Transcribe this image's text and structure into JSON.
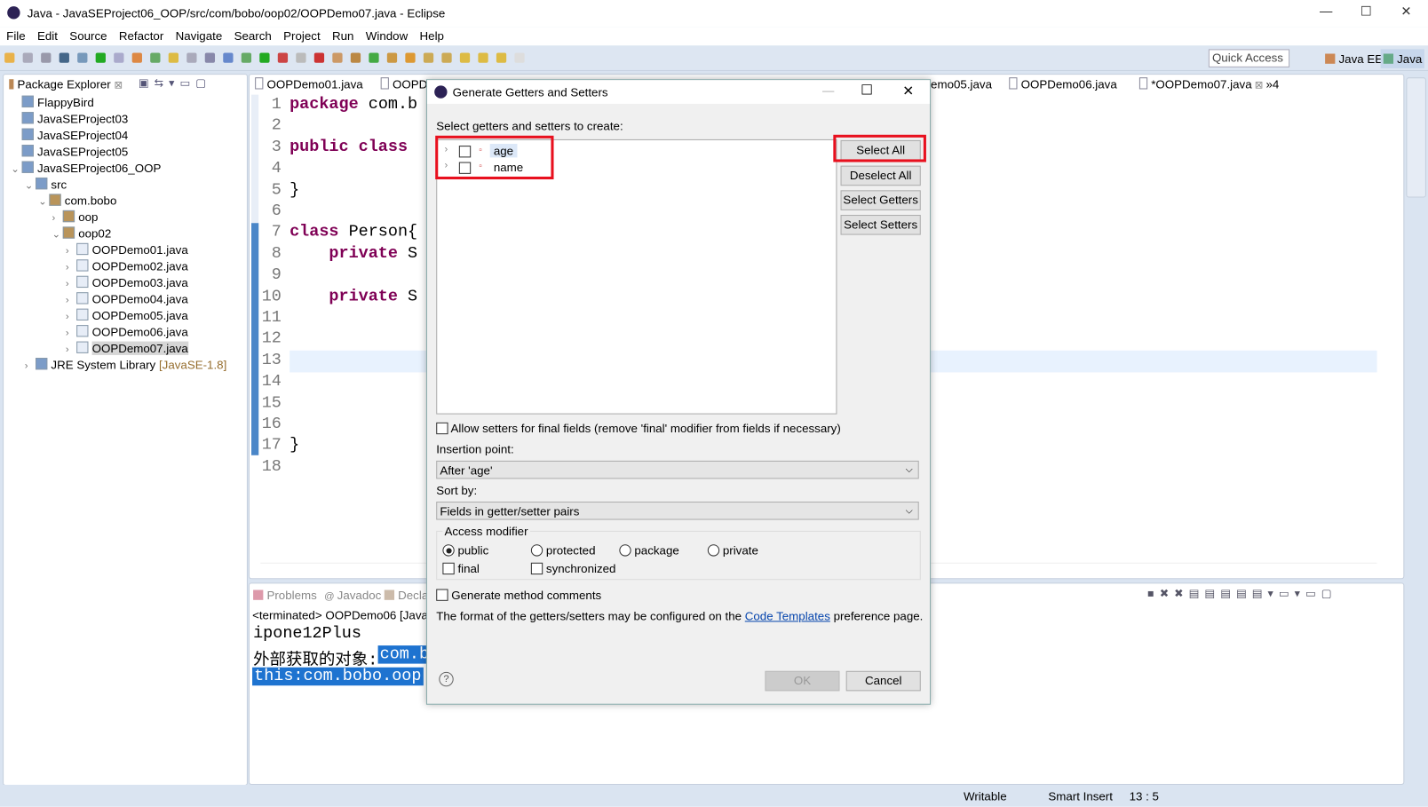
{
  "window": {
    "title": "Java - JavaSEProject06_OOP/src/com/bobo/oop02/OOPDemo07.java - Eclipse",
    "minimize": "—",
    "maximize": "☐",
    "close": "✕"
  },
  "menu": [
    "File",
    "Edit",
    "Source",
    "Refactor",
    "Navigate",
    "Search",
    "Project",
    "Run",
    "Window",
    "Help"
  ],
  "toolbar": {
    "quick_access_placeholder": "Quick Access",
    "perspectives": [
      "Java EE",
      "Java"
    ]
  },
  "package_explorer": {
    "title": "Package Explorer",
    "items": [
      {
        "label": "FlappyBird",
        "level": 0
      },
      {
        "label": "JavaSEProject03",
        "level": 0
      },
      {
        "label": "JavaSEProject04",
        "level": 0
      },
      {
        "label": "JavaSEProject05",
        "level": 0
      },
      {
        "label": "JavaSEProject06_OOP",
        "level": 0,
        "expanded": true
      },
      {
        "label": "src",
        "level": 1,
        "expanded": true
      },
      {
        "label": "com.bobo",
        "level": 2,
        "expanded": true
      },
      {
        "label": "oop",
        "level": 3
      },
      {
        "label": "oop02",
        "level": 3,
        "expanded": true
      },
      {
        "label": "OOPDemo01.java",
        "level": 4
      },
      {
        "label": "OOPDemo02.java",
        "level": 4
      },
      {
        "label": "OOPDemo03.java",
        "level": 4
      },
      {
        "label": "OOPDemo04.java",
        "level": 4
      },
      {
        "label": "OOPDemo05.java",
        "level": 4
      },
      {
        "label": "OOPDemo06.java",
        "level": 4
      },
      {
        "label": "OOPDemo07.java",
        "level": 4,
        "selected": true
      },
      {
        "label": "JRE System Library",
        "suffix": "[JavaSE-1.8]",
        "level": 1
      }
    ]
  },
  "editor": {
    "tabs": [
      "OOPDemo01.java",
      "OOPDe",
      "emo05.java",
      "OOPDemo06.java",
      "*OOPDemo07.java"
    ],
    "overflow": "»4",
    "line_numbers": [
      "1",
      "2",
      "3",
      "4",
      "5",
      "6",
      "7",
      "8",
      "9",
      "10",
      "11",
      "12",
      "13",
      "14",
      "15",
      "16",
      "17",
      "18"
    ],
    "lines": [
      {
        "n": 1,
        "kw": "package",
        "rest": " com.b"
      },
      {
        "n": 3,
        "kw": "public class",
        "rest": ""
      },
      {
        "n": 5,
        "kw": "",
        "rest": "}"
      },
      {
        "n": 7,
        "kw": "class",
        "rest": " Person{"
      },
      {
        "n": 8,
        "kw": "    private",
        "rest": " S"
      },
      {
        "n": 10,
        "kw": "    private",
        "rest": " S"
      },
      {
        "n": 17,
        "kw": "",
        "rest": "}"
      }
    ]
  },
  "console": {
    "tabs": [
      "Problems",
      "Javadoc",
      "Decla"
    ],
    "header": "<terminated> OOPDemo06 [Java A",
    "lines": [
      "ipone12Plus",
      "外部获取的对象:",
      "com.b",
      "this:com.bobo.oop"
    ]
  },
  "dialog": {
    "title": "Generate Getters and Setters",
    "prompt": "Select getters and setters to create:",
    "fields": [
      {
        "name": "age",
        "checked": false
      },
      {
        "name": "name",
        "checked": false
      }
    ],
    "buttons": {
      "select_all": "Select All",
      "deselect_all": "Deselect All",
      "select_getters": "Select Getters",
      "select_setters": "Select Setters",
      "ok": "OK",
      "cancel": "Cancel"
    },
    "allow_final": "Allow setters for final fields (remove 'final' modifier from fields if necessary)",
    "insertion_label": "Insertion point:",
    "insertion_value": "After 'age'",
    "sort_label": "Sort by:",
    "sort_value": "Fields in getter/setter pairs",
    "access_label": "Access modifier",
    "access": [
      "public",
      "protected",
      "package",
      "private"
    ],
    "access_selected": "public",
    "final_label": "final",
    "synchronized_label": "synchronized",
    "comments_label": "Generate method comments",
    "note_before": "The format of the getters/setters may be configured on the ",
    "note_link": "Code Templates",
    "note_after": " preference page.",
    "help": "?",
    "highlight_color": "#e8101e"
  },
  "status": {
    "writable": "Writable",
    "insert": "Smart Insert",
    "position": "13 : 5"
  }
}
